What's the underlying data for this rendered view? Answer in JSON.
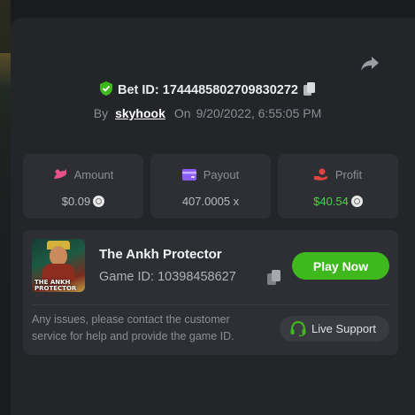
{
  "bet": {
    "label": "Bet ID:",
    "id": "1744485802709830272"
  },
  "meta": {
    "by_label": "By",
    "username": "skyhook",
    "on_label": "On",
    "datetime": "9/20/2022, 6:55:05 PM"
  },
  "stats": [
    {
      "label": "Amount",
      "value": "$0.09",
      "icon": "amount-icon",
      "icon_color": "#e8508a"
    },
    {
      "label": "Payout",
      "value": "407.0005 x",
      "icon": "wallet-icon",
      "icon_color": "#8b5cf6"
    },
    {
      "label": "Profit",
      "value": "$40.54",
      "icon": "profit-hand-icon",
      "icon_color": "#e0443e"
    }
  ],
  "game": {
    "title": "The Ankh Protector",
    "id_text": "Game ID: 10398458627",
    "thumb_line1": "THE ANKH",
    "thumb_line2": "PROTECTOR",
    "play_label": "Play Now"
  },
  "support": {
    "line1": "Any issues, please contact the customer",
    "line2": "service for help and provide the game ID.",
    "button_label": "Live Support"
  },
  "colors": {
    "accent_green": "#3fb81e",
    "profit_green": "#4bd34b",
    "panel": "#232529",
    "card": "#2d2f34"
  }
}
